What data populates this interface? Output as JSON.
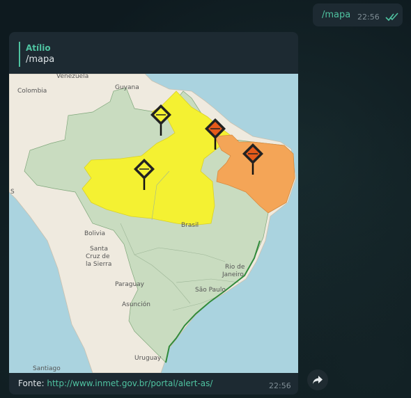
{
  "outgoing": {
    "text": "/mapa",
    "time": "22:56",
    "status_icon": "double-check-icon"
  },
  "incoming": {
    "reply": {
      "author": "Atílio",
      "text": "/mapa"
    },
    "caption_prefix": "Fonte: ",
    "link": "http://www.inmet.gov.br/portal/alert-as/",
    "time": "22:56"
  },
  "map": {
    "labels": {
      "venezuela": "Venezuela",
      "guyana": "Guyana",
      "colombia": "Colombia",
      "bolivia": "Bolivia",
      "santa_cruz_1": "Santa",
      "santa_cruz_2": "Cruz de",
      "santa_cruz_3": "la Sierra",
      "paraguay": "Paraguay",
      "asuncion": "Asunción",
      "rio_1": "Rio de",
      "rio_2": "Janeiro",
      "sao_paulo": "São Paulo",
      "uruguay": "Uruguay",
      "santiago": "Santiago",
      "brasil": "Brasil",
      "s_coast": "S"
    },
    "colors": {
      "ocean": "#aad3df",
      "land": "#efeadf",
      "brazil_base": "#c9dcc0",
      "yellow_alert": "#f4f132",
      "orange_alert": "#f4a557"
    },
    "markers": [
      {
        "level": "yellow",
        "icon": "yellow-alert-marker-icon"
      },
      {
        "level": "orange",
        "icon": "orange-alert-marker-icon"
      },
      {
        "level": "yellow",
        "icon": "yellow-alert-marker-icon"
      },
      {
        "level": "orange",
        "icon": "orange-alert-marker-icon"
      }
    ]
  },
  "actions": {
    "forward_icon": "forward-icon"
  }
}
